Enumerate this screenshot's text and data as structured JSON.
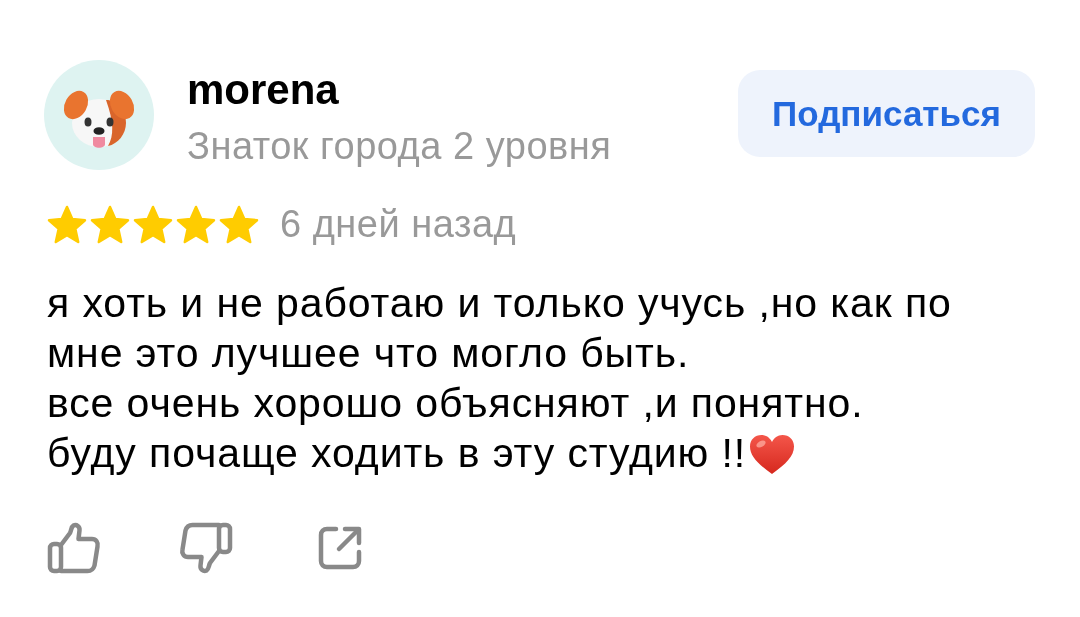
{
  "review": {
    "author": {
      "name": "morena",
      "badge": "Знаток города 2 уровня"
    },
    "subscribe_button": "Подписаться",
    "rating": {
      "stars": 5
    },
    "date": "6 дней назад",
    "paragraphs": [
      "я хоть и не работаю и только учусь ,но как по\nмне это лучшее что могло быть.",
      "все очень хорошо объясняют ,и понятно.",
      "буду почаще ходить в эту студию !!"
    ],
    "actions": [
      {
        "kind": "like"
      },
      {
        "kind": "dislike"
      },
      {
        "kind": "share"
      }
    ]
  }
}
